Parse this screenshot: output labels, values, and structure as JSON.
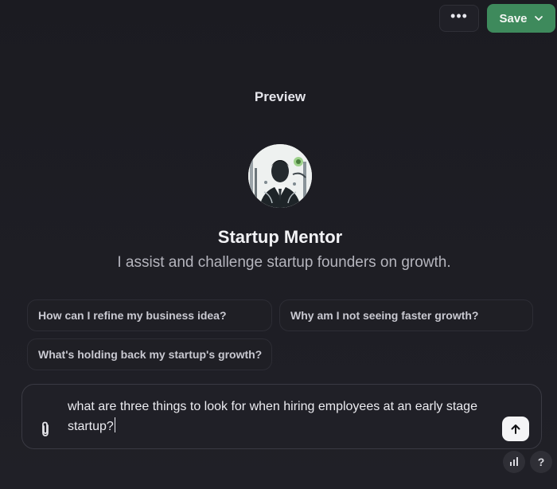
{
  "header": {
    "more_label": "•••",
    "save_label": "Save",
    "save_color": "#3e8a5c"
  },
  "preview": {
    "title": "Preview",
    "gpt_name": "Startup Mentor",
    "gpt_description": "I assist and challenge startup founders on growth.",
    "avatar_icon": "businessman-portrait-icon"
  },
  "conversation_starters": [
    "How can I refine my business idea?",
    "Why am I not seeing faster growth?",
    "What's holding back my startup's growth?"
  ],
  "composer": {
    "value": "what are three things to look for when hiring employees at an early stage startup?",
    "attach_icon": "paperclip-icon",
    "send_icon": "arrow-up-icon"
  },
  "footer": {
    "stats_icon": "bar-chart-icon",
    "help_label": "?"
  }
}
